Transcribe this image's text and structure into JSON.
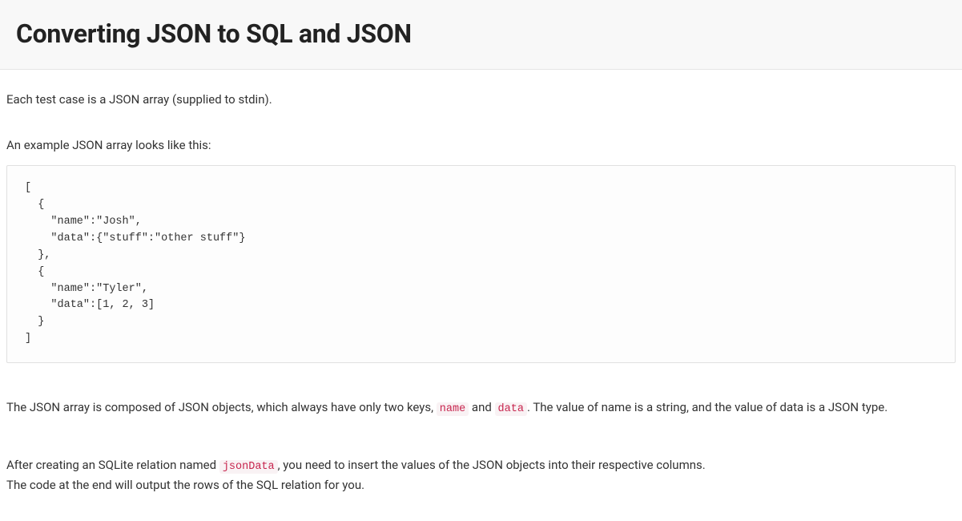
{
  "header": {
    "title": "Converting JSON to SQL and JSON"
  },
  "body": {
    "intro": "Each test case is a JSON array (supplied to stdin).",
    "example_lead": "An example JSON array looks like this:",
    "code_block": "[\n  {\n    \"name\":\"Josh\",\n    \"data\":{\"stuff\":\"other stuff\"}\n  },\n  {\n    \"name\":\"Tyler\",\n    \"data\":[1, 2, 3]\n  }\n]",
    "explain_pre": "The JSON array is composed of JSON objects, which always have only two keys, ",
    "code_name": "name",
    "explain_mid1": " and ",
    "code_data": "data",
    "explain_post1": ". The value of name is a string, and the value of data is a JSON type.",
    "instr_pre": "After creating an SQLite relation named ",
    "code_jsonData": "jsonData",
    "instr_post": ", you need to insert the values of the JSON objects into their respective columns.",
    "instr_line2": "The code at the end will output the rows of the SQL relation for you."
  }
}
